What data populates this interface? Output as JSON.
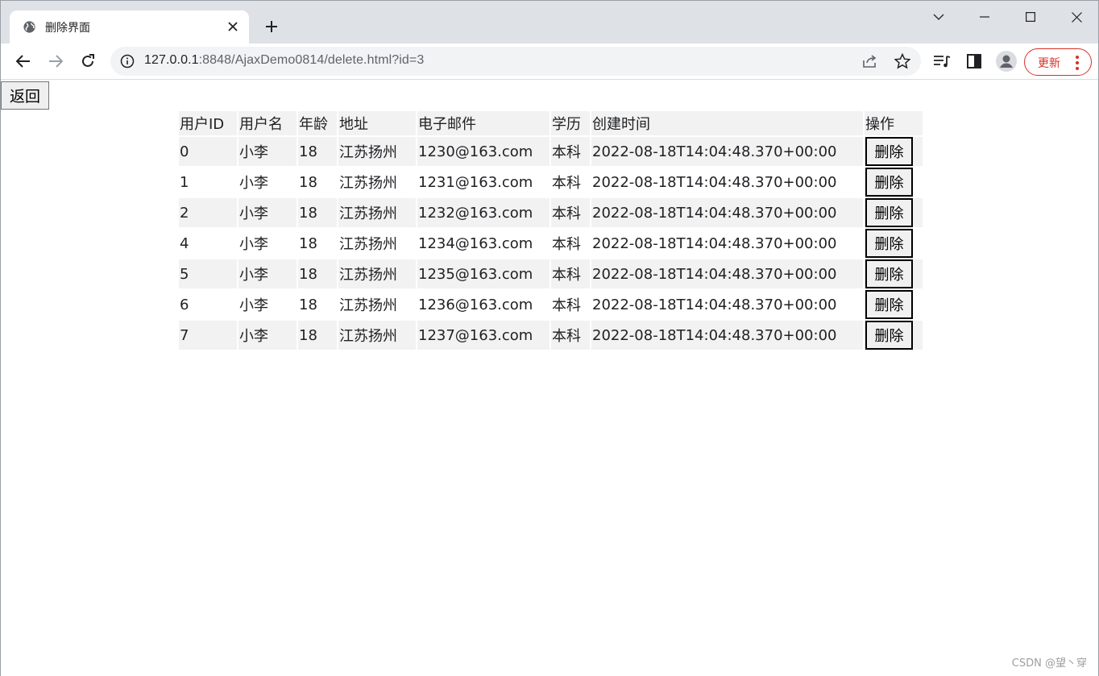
{
  "browser": {
    "tab_title": "删除界面",
    "url_host": "127.0.0.1",
    "url_rest": ":8848/AjaxDemo0814/delete.html?id=3",
    "update_label": "更新",
    "accent_color": "#d93025"
  },
  "page": {
    "back_label": "返回",
    "table": {
      "headers": [
        "用户ID",
        "用户名",
        "年龄",
        "地址",
        "电子邮件",
        "学历",
        "创建时间",
        "操作"
      ],
      "delete_label": "删除",
      "rows": [
        {
          "id": "0",
          "name": "小李",
          "age": "18",
          "address": "江苏扬州",
          "email": "1230@163.com",
          "education": "本科",
          "created": "2022-08-18T14:04:48.370+00:00"
        },
        {
          "id": "1",
          "name": "小李",
          "age": "18",
          "address": "江苏扬州",
          "email": "1231@163.com",
          "education": "本科",
          "created": "2022-08-18T14:04:48.370+00:00"
        },
        {
          "id": "2",
          "name": "小李",
          "age": "18",
          "address": "江苏扬州",
          "email": "1232@163.com",
          "education": "本科",
          "created": "2022-08-18T14:04:48.370+00:00"
        },
        {
          "id": "4",
          "name": "小李",
          "age": "18",
          "address": "江苏扬州",
          "email": "1234@163.com",
          "education": "本科",
          "created": "2022-08-18T14:04:48.370+00:00"
        },
        {
          "id": "5",
          "name": "小李",
          "age": "18",
          "address": "江苏扬州",
          "email": "1235@163.com",
          "education": "本科",
          "created": "2022-08-18T14:04:48.370+00:00"
        },
        {
          "id": "6",
          "name": "小李",
          "age": "18",
          "address": "江苏扬州",
          "email": "1236@163.com",
          "education": "本科",
          "created": "2022-08-18T14:04:48.370+00:00"
        },
        {
          "id": "7",
          "name": "小李",
          "age": "18",
          "address": "江苏扬州",
          "email": "1237@163.com",
          "education": "本科",
          "created": "2022-08-18T14:04:48.370+00:00"
        }
      ]
    }
  },
  "watermark": "CSDN @望丶穿"
}
